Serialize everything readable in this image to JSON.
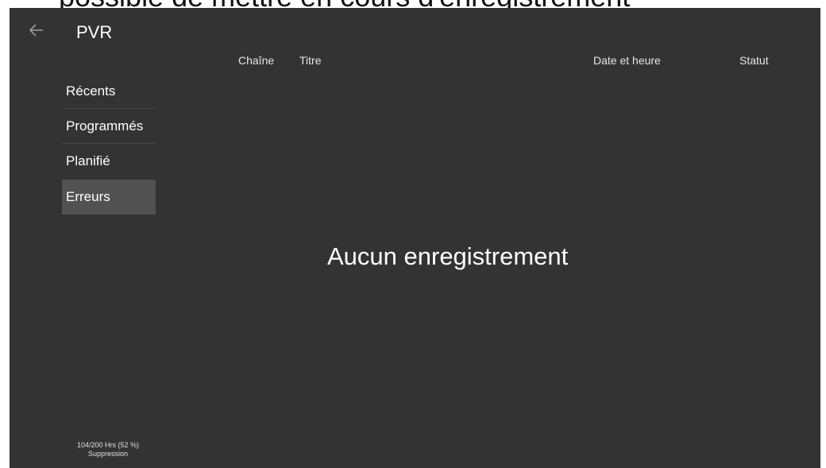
{
  "top_strip": {
    "text": "possible de mettre en cours d'enregistrement"
  },
  "header": {
    "back_icon": "arrow-left-icon",
    "title": "PVR"
  },
  "columns": [
    "Chaîne",
    "Titre",
    "Date et heure",
    "Statut"
  ],
  "sidebar": {
    "items": [
      {
        "label": "Récents",
        "active": false
      },
      {
        "label": "Programmés",
        "active": false
      },
      {
        "label": "Planifié",
        "active": false
      },
      {
        "label": "Erreurs",
        "active": true
      }
    ]
  },
  "main": {
    "empty_message": "Aucun enregistrement"
  },
  "storage": {
    "usage": "104/200 Hrs (52 %)",
    "usage_fraction": 0.52,
    "mode": "Suppression"
  },
  "colors": {
    "background": "#333333",
    "active_item": "#525252",
    "text": "#ffffff"
  }
}
